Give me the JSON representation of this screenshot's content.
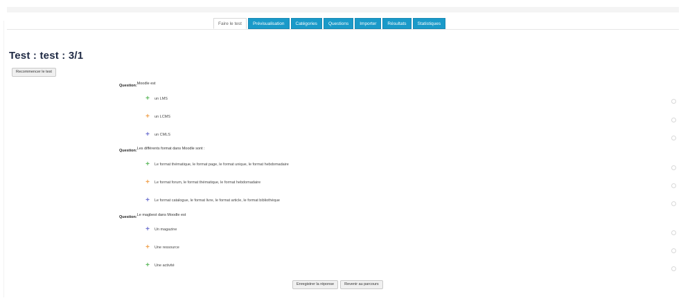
{
  "tabs": [
    {
      "label": "Faire le test",
      "active": true
    },
    {
      "label": "Prévisualisation",
      "active": false
    },
    {
      "label": "Catégories",
      "active": false
    },
    {
      "label": "Questions",
      "active": false
    },
    {
      "label": "Importer",
      "active": false
    },
    {
      "label": "Résultats",
      "active": false
    },
    {
      "label": "Statistiques",
      "active": false
    }
  ],
  "page": {
    "title": "Test : test : 3/1",
    "restart_label": "Recommencer le test"
  },
  "question_label": "Question:",
  "questions": [
    {
      "text": "Moodle est",
      "answers": [
        {
          "text": "un LMS",
          "color": "#5cb85c"
        },
        {
          "text": "un LCMS",
          "color": "#f0a04b"
        },
        {
          "text": "un CMLS",
          "color": "#6a6fcf"
        }
      ]
    },
    {
      "text": "Les différents format dans Moodle sont :",
      "answers": [
        {
          "text": "Le format thématique, le format page, le format unique, le format hebdomadaire",
          "color": "#5cb85c"
        },
        {
          "text": "Le format forum, le format thématique, le format hebdomadaire",
          "color": "#f0a04b"
        },
        {
          "text": "Le format catalogue, le format livre, le format article, le format bibliothèque",
          "color": "#6a6fcf"
        }
      ]
    },
    {
      "text": "Le magbest dans Moodle est",
      "answers": [
        {
          "text": "Un magazine",
          "color": "#6a6fcf"
        },
        {
          "text": "Une ressource",
          "color": "#f0a04b"
        },
        {
          "text": "Une activité",
          "color": "#5cb85c"
        }
      ]
    }
  ],
  "actions": {
    "save_label": "Enregistrer la réponse",
    "back_label": "Revenir au parcours"
  },
  "colors": {
    "tab_bg": "#1a9ac9",
    "title": "#1f2a44"
  },
  "icons": {
    "answer_marker": "plus-icon"
  }
}
